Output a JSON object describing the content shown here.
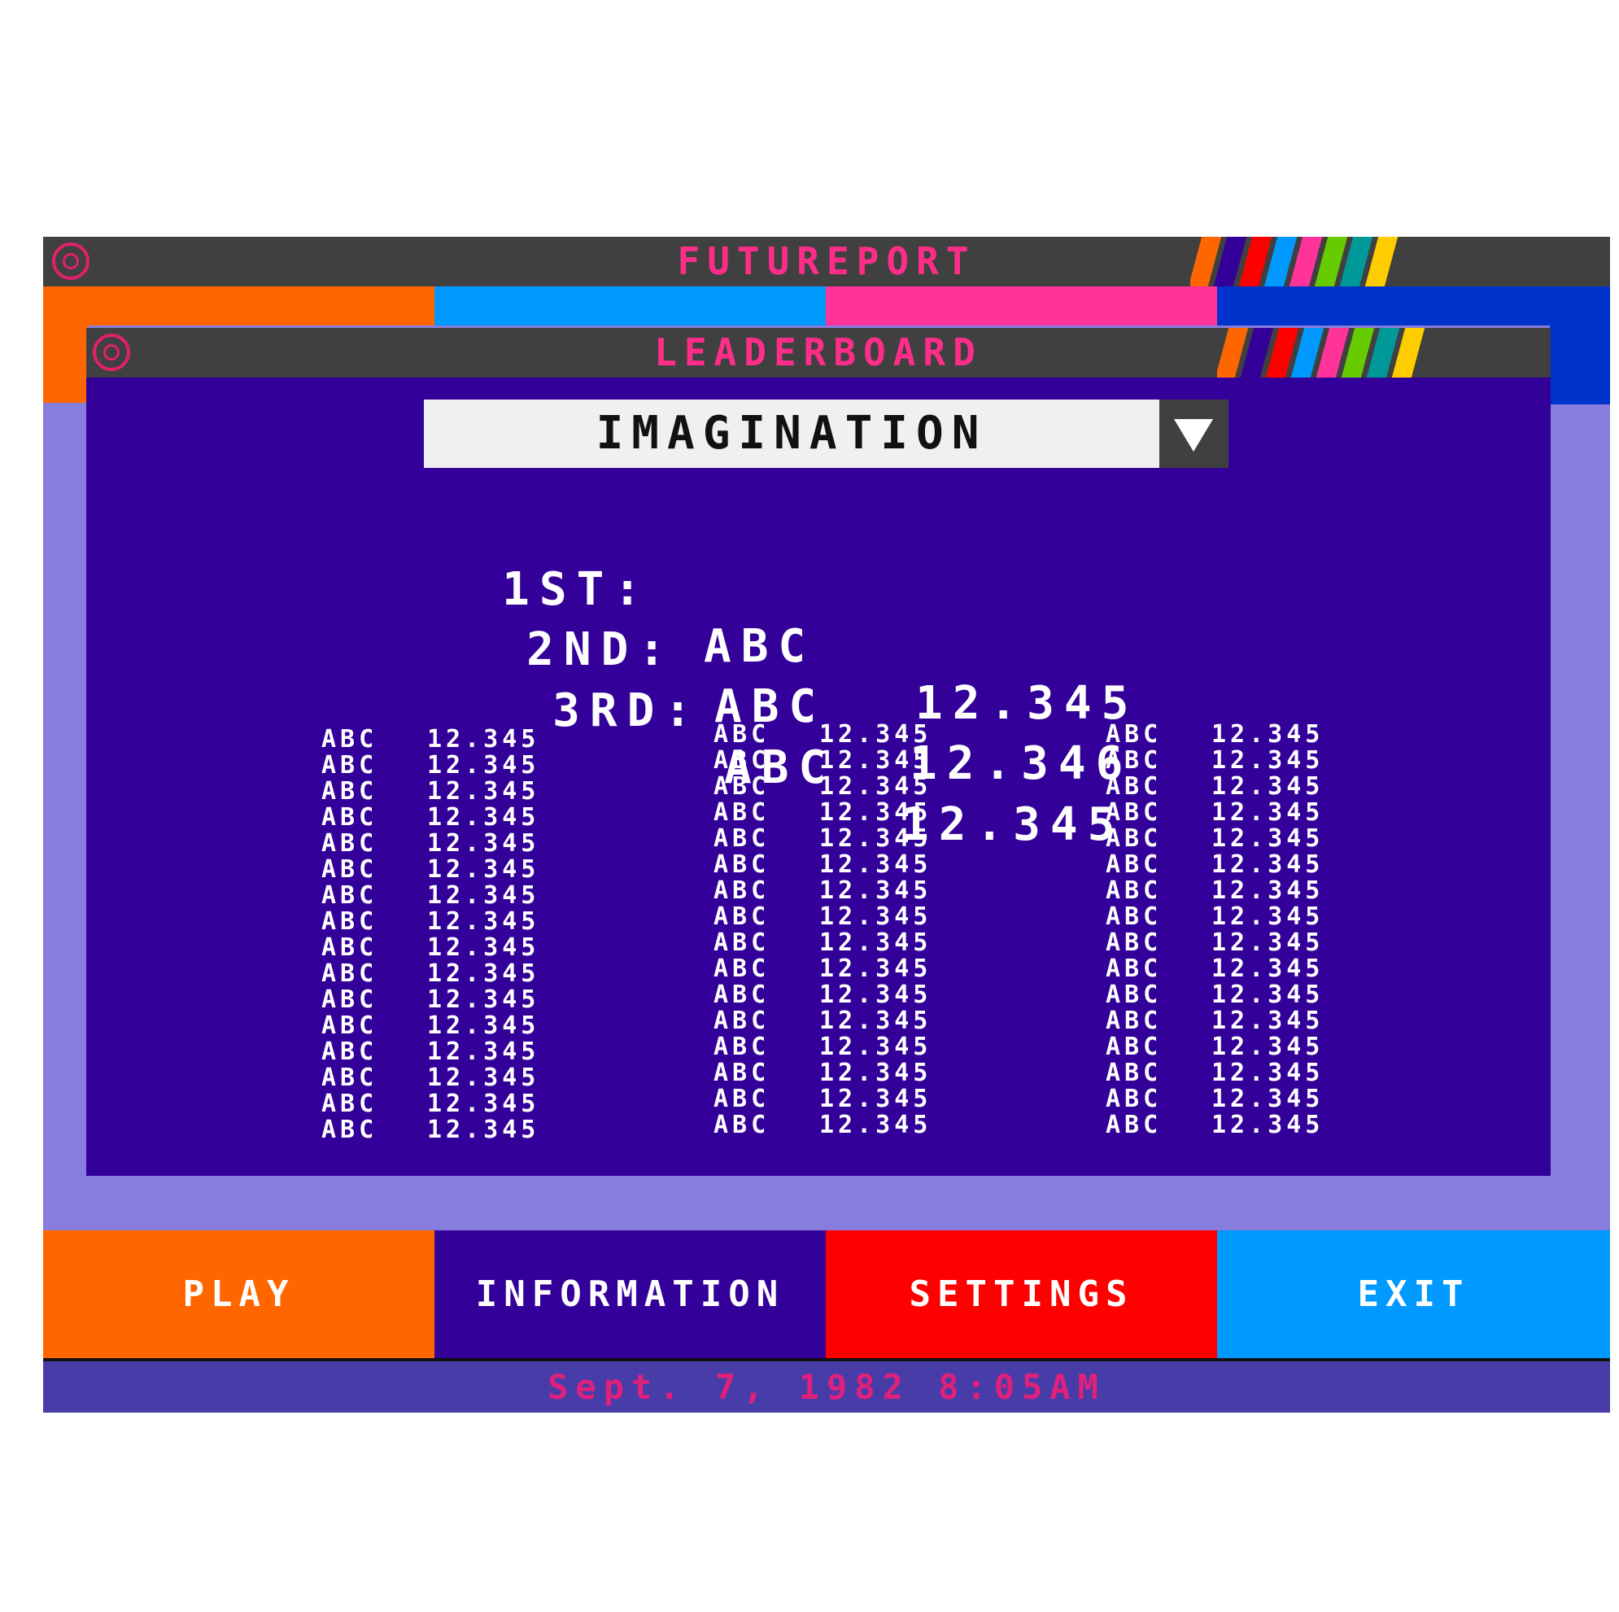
{
  "outer_window": {
    "title": "FUTUREPORT"
  },
  "leaderboard": {
    "title": "LEADERBOARD",
    "category": "IMAGINATION",
    "podium": [
      {
        "rank": "1ST:",
        "name": "ABC",
        "score": "12.345"
      },
      {
        "rank": "2ND:",
        "name": "ABC",
        "score": "12.346"
      },
      {
        "rank": "3RD:",
        "name": "ABC",
        "score": "12.345"
      }
    ],
    "columns": [
      {
        "rows": [
          {
            "name": "ABC",
            "score": "12.345"
          },
          {
            "name": "ABC",
            "score": "12.345"
          },
          {
            "name": "ABC",
            "score": "12.345"
          },
          {
            "name": "ABC",
            "score": "12.345"
          },
          {
            "name": "ABC",
            "score": "12.345"
          },
          {
            "name": "ABC",
            "score": "12.345"
          },
          {
            "name": "ABC",
            "score": "12.345"
          },
          {
            "name": "ABC",
            "score": "12.345"
          },
          {
            "name": "ABC",
            "score": "12.345"
          },
          {
            "name": "ABC",
            "score": "12.345"
          },
          {
            "name": "ABC",
            "score": "12.345"
          },
          {
            "name": "ABC",
            "score": "12.345"
          },
          {
            "name": "ABC",
            "score": "12.345"
          },
          {
            "name": "ABC",
            "score": "12.345"
          },
          {
            "name": "ABC",
            "score": "12.345"
          },
          {
            "name": "ABC",
            "score": "12.345"
          }
        ]
      },
      {
        "rows": [
          {
            "name": "ABC",
            "score": "12.345"
          },
          {
            "name": "ABC",
            "score": "12.345"
          },
          {
            "name": "ABC",
            "score": "12.345"
          },
          {
            "name": "ABC",
            "score": "12.345"
          },
          {
            "name": "ABC",
            "score": "12.345"
          },
          {
            "name": "ABC",
            "score": "12.345"
          },
          {
            "name": "ABC",
            "score": "12.345"
          },
          {
            "name": "ABC",
            "score": "12.345"
          },
          {
            "name": "ABC",
            "score": "12.345"
          },
          {
            "name": "ABC",
            "score": "12.345"
          },
          {
            "name": "ABC",
            "score": "12.345"
          },
          {
            "name": "ABC",
            "score": "12.345"
          },
          {
            "name": "ABC",
            "score": "12.345"
          },
          {
            "name": "ABC",
            "score": "12.345"
          },
          {
            "name": "ABC",
            "score": "12.345"
          },
          {
            "name": "ABC",
            "score": "12.345"
          }
        ]
      },
      {
        "rows": [
          {
            "name": "ABC",
            "score": "12.345"
          },
          {
            "name": "ABC",
            "score": "12.345"
          },
          {
            "name": "ABC",
            "score": "12.345"
          },
          {
            "name": "ABC",
            "score": "12.345"
          },
          {
            "name": "ABC",
            "score": "12.345"
          },
          {
            "name": "ABC",
            "score": "12.345"
          },
          {
            "name": "ABC",
            "score": "12.345"
          },
          {
            "name": "ABC",
            "score": "12.345"
          },
          {
            "name": "ABC",
            "score": "12.345"
          },
          {
            "name": "ABC",
            "score": "12.345"
          },
          {
            "name": "ABC",
            "score": "12.345"
          },
          {
            "name": "ABC",
            "score": "12.345"
          },
          {
            "name": "ABC",
            "score": "12.345"
          },
          {
            "name": "ABC",
            "score": "12.345"
          },
          {
            "name": "ABC",
            "score": "12.345"
          },
          {
            "name": "ABC",
            "score": "12.345"
          }
        ]
      }
    ]
  },
  "nav": {
    "play": "PLAY",
    "information": "INFORMATION",
    "settings": "SETTINGS",
    "exit": "EXIT"
  },
  "status": {
    "datetime": "Sept. 7, 1982 8:05AM"
  },
  "colors": {
    "titlebar": "#404040",
    "title_text": "#ff2d8a",
    "orange": "#ff6600",
    "cyan": "#0099ff",
    "pink": "#ff3399",
    "blue": "#0033cc",
    "indigo": "#330099",
    "lavender": "#877ddc",
    "red": "#ff0000",
    "status_bg": "#483ca8",
    "stripes": [
      "#ff6600",
      "#330099",
      "#ff0000",
      "#0099ff",
      "#ff3399",
      "#66cc00",
      "#009999",
      "#ffcc00"
    ]
  },
  "icons": {
    "logo": "porthole-logo-icon",
    "dropdown": "triangle-down-icon"
  }
}
